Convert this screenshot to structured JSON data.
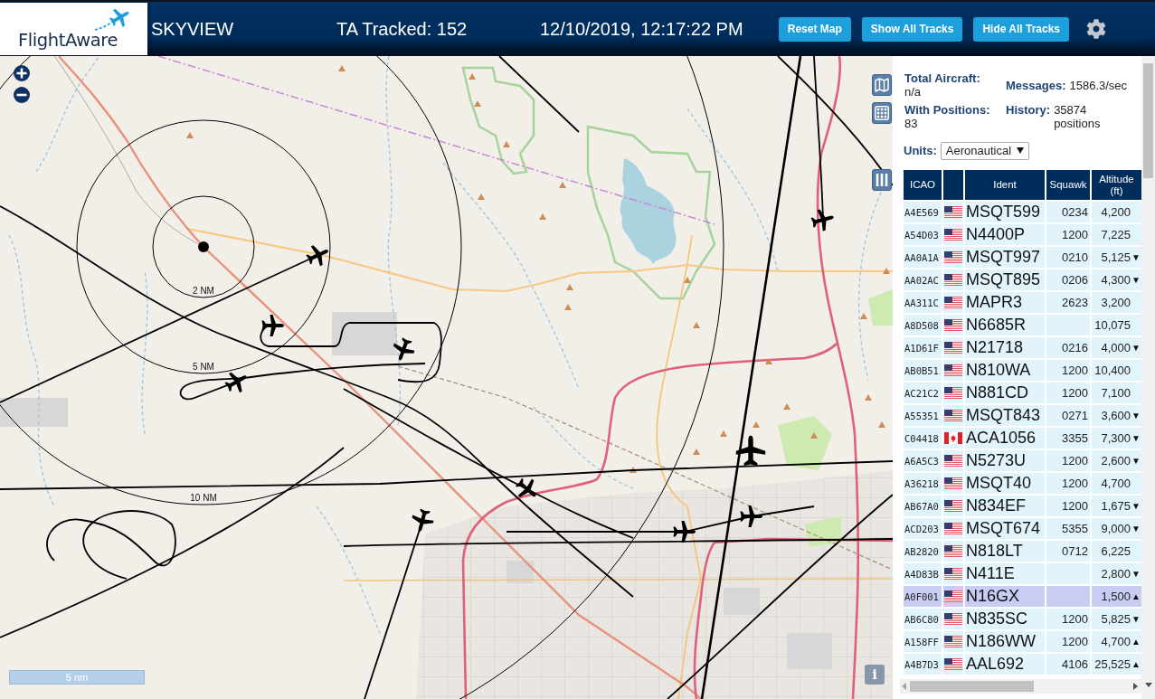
{
  "header": {
    "logo": "FlightAware",
    "title": "SKYVIEW",
    "tracked": "TA Tracked: 152",
    "datetime": "12/10/2019, 12:17:22 PM",
    "buttons": [
      "Reset Map",
      "Show All Tracks",
      "Hide All Tracks"
    ]
  },
  "map": {
    "range_rings": [
      {
        "label": "2 NM"
      },
      {
        "label": "5 NM"
      },
      {
        "label": "10 NM"
      }
    ],
    "scale": "5 nm",
    "info_button": "i"
  },
  "stats": [
    {
      "label": "Total Aircraft:",
      "value": "n/a"
    },
    {
      "label": "Messages:",
      "value": "1586.3/sec"
    },
    {
      "label": "With Positions:",
      "value": "83"
    },
    {
      "label": "History:",
      "value": "35874 positions"
    }
  ],
  "units": {
    "label": "Units:",
    "value": "Aeronautical"
  },
  "table": {
    "columns": [
      "ICAO",
      "Ident",
      "Squawk",
      "Altitude (ft)"
    ],
    "rows": [
      {
        "icao": "A4E569",
        "flag": {
          "kind": "us"
        },
        "ident": "MSQT599",
        "squawk": "0234",
        "altitude": "4,200",
        "selected": false
      },
      {
        "icao": "A54D03",
        "flag": {
          "kind": "us"
        },
        "ident": "N4400P",
        "squawk": "1200",
        "altitude": "7,225",
        "selected": false
      },
      {
        "icao": "AA0A1A",
        "flag": {
          "kind": "us"
        },
        "ident": "MSQT997",
        "squawk": "0210",
        "altitude": "5,125",
        "trend": "▼",
        "selected": false
      },
      {
        "icao": "AA02AC",
        "flag": {
          "kind": "us"
        },
        "ident": "MSQT895",
        "squawk": "0206",
        "altitude": "4,300",
        "trend": "▼",
        "selected": false
      },
      {
        "icao": "AA311C",
        "flag": {
          "kind": "us"
        },
        "ident": "MAPR3",
        "squawk": "2623",
        "altitude": "3,200",
        "selected": false
      },
      {
        "icao": "A8D508",
        "flag": {
          "kind": "us"
        },
        "ident": "N6685R",
        "altitude": "10,075",
        "selected": false
      },
      {
        "icao": "A1D61F",
        "flag": {
          "kind": "us"
        },
        "ident": "N21718",
        "squawk": "0216",
        "altitude": "4,000",
        "trend": "▼",
        "selected": false
      },
      {
        "icao": "AB0B51",
        "flag": {
          "kind": "us"
        },
        "ident": "N810WA",
        "squawk": "1200",
        "altitude": "10,400",
        "selected": false
      },
      {
        "icao": "AC21C2",
        "flag": {
          "kind": "us"
        },
        "ident": "N881CD",
        "squawk": "1200",
        "altitude": "7,100",
        "selected": false
      },
      {
        "icao": "A55351",
        "flag": {
          "kind": "us"
        },
        "ident": "MSQT843",
        "squawk": "0271",
        "altitude": "3,600",
        "trend": "▼",
        "selected": false
      },
      {
        "icao": "C04418",
        "flag": {
          "kind": "ca"
        },
        "ident": "ACA1056",
        "squawk": "3355",
        "altitude": "7,300",
        "trend": "▼",
        "selected": false
      },
      {
        "icao": "A6A5C3",
        "flag": {
          "kind": "us"
        },
        "ident": "N5273U",
        "squawk": "1200",
        "altitude": "2,600",
        "trend": "▼",
        "selected": false
      },
      {
        "icao": "A36218",
        "flag": {
          "kind": "us"
        },
        "ident": "MSQT40",
        "squawk": "1200",
        "altitude": "4,700",
        "selected": false
      },
      {
        "icao": "AB67A0",
        "flag": {
          "kind": "us"
        },
        "ident": "N834EF",
        "squawk": "1200",
        "altitude": "1,675",
        "trend": "▼",
        "selected": false
      },
      {
        "icao": "ACD203",
        "flag": {
          "kind": "us"
        },
        "ident": "MSQT674",
        "squawk": "5355",
        "altitude": "9,000",
        "trend": "▼",
        "selected": false
      },
      {
        "icao": "AB2820",
        "flag": {
          "kind": "us"
        },
        "ident": "N818LT",
        "squawk": "0712",
        "altitude": "6,225",
        "selected": false
      },
      {
        "icao": "A4D83B",
        "flag": {
          "kind": "us"
        },
        "ident": "N411E",
        "altitude": "2,800",
        "trend": "▼",
        "selected": false
      },
      {
        "icao": "A0F001",
        "flag": {
          "kind": "us"
        },
        "ident": "N16GX",
        "altitude": "1,500",
        "trend": "▲",
        "selected": true
      },
      {
        "icao": "AB6C80",
        "flag": {
          "kind": "us"
        },
        "ident": "N835SC",
        "squawk": "1200",
        "altitude": "5,825",
        "trend": "▼",
        "selected": false
      },
      {
        "icao": "A158FF",
        "flag": {
          "kind": "us"
        },
        "ident": "N186WW",
        "squawk": "1200",
        "altitude": "4,700",
        "trend": "▲",
        "selected": false
      },
      {
        "icao": "A4B7D3",
        "flag": {
          "kind": "us"
        },
        "ident": "AAL692",
        "squawk": "4106",
        "altitude": "25,525",
        "trend": "▲",
        "selected": false
      }
    ]
  }
}
